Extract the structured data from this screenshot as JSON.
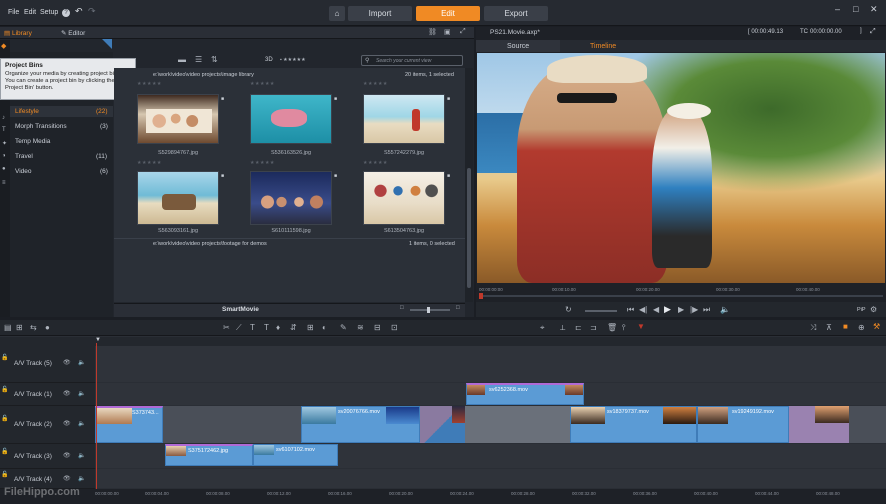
{
  "menu": {
    "file": "File",
    "edit": "Edit",
    "setup": "Setup",
    "help": "?"
  },
  "nav": {
    "import": "Import",
    "edit": "Edit",
    "export": "Export"
  },
  "window_controls": [
    "–",
    "□",
    "✕"
  ],
  "library": {
    "tab_library": "Library",
    "tab_editor": "Editor",
    "tooltip_title": "Project Bins",
    "tooltip_body": "Organize your media by creating project bins. You can create a project bin by clicking the 'New Project Bin' button.",
    "view_3d": "3D",
    "search_placeholder": "Search your current view",
    "path1": "e:\\work\\video\\video projects\\image library",
    "count1": "20 items, 1 selected",
    "path2": "e:\\work\\video\\video projects\\footage for demos",
    "count2": "1 items, 0 selected",
    "smartmovie": "SmartMovie",
    "bins": [
      {
        "label": "Lifestyle",
        "count": "(22)",
        "active": true
      },
      {
        "label": "Morph Transitions",
        "count": "(3)"
      },
      {
        "label": "Temp Media",
        "count": ""
      },
      {
        "label": "Travel",
        "count": "(11)"
      },
      {
        "label": "Video",
        "count": "(6)"
      }
    ],
    "thumbs": [
      {
        "name": "S529894767.jpg"
      },
      {
        "name": "S536163526.jpg"
      },
      {
        "name": "S557242279.jpg"
      },
      {
        "name": "S563093161.jpg"
      },
      {
        "name": "S610111598.jpg"
      },
      {
        "name": "S613504763.jpg"
      }
    ]
  },
  "preview": {
    "project": "PS21.Movie.axp*",
    "timecode_left": "[ 00:00:49.13",
    "tc_label": "TC",
    "timecode_right": "00:00:00.00",
    "tab_source": "Source",
    "tab_timeline": "Timeline",
    "ruler": [
      "00:00:00:00",
      "00:00:10.00",
      "00:00:20.00",
      "00:00:30.00",
      "00:00:40.00"
    ],
    "pip": "PiP"
  },
  "timeline": {
    "tracks": [
      {
        "label": "A/V Track (5)"
      },
      {
        "label": "A/V Track (1)"
      },
      {
        "label": "A/V Track (2)"
      },
      {
        "label": "A/V Track (3)"
      },
      {
        "label": "A/V Track (4)"
      }
    ],
    "clips": {
      "c1": "sv6252368.mov",
      "c2": "S373743...",
      "c3": "sv20076766.mov",
      "c4": "sv18379737.mov",
      "c5": "sv19249192.mov",
      "c6": "S375172462.jpg",
      "c7": "sv6107102.mov"
    },
    "ruler": [
      "00:00:00.00",
      "00:00:04.00",
      "00:00:08.00",
      "00:00:12.00",
      "00:00:16.00",
      "00:00:20.00",
      "00:00:24.00",
      "00:00:28.00",
      "00:00:32.00",
      "00:00:36.00",
      "00:00:40.00",
      "00:00:44.00",
      "00:00:48.00"
    ]
  },
  "watermark": "FileHippo.com",
  "colors": {
    "accent": "#f08a24",
    "clip": "#5b9bd5",
    "selected": "#b06ad6"
  }
}
